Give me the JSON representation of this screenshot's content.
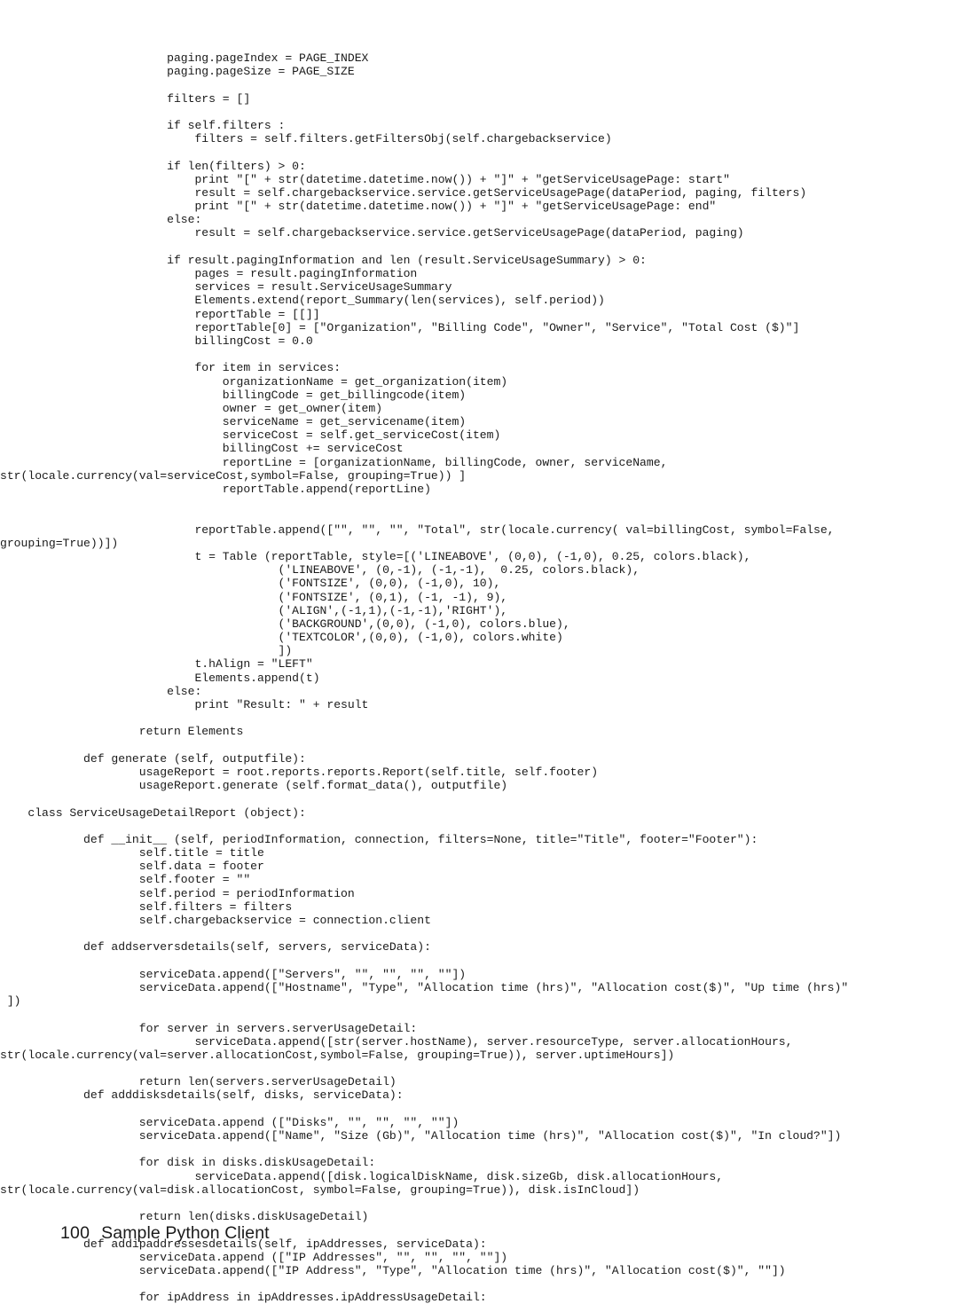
{
  "document": {
    "page_number": "100",
    "section_title": "Sample Python Client"
  },
  "code": {
    "language": "python",
    "lines": [
      "                        paging.pageIndex = PAGE_INDEX",
      "                        paging.pageSize = PAGE_SIZE",
      "",
      "                        filters = []",
      "",
      "                        if self.filters :",
      "                            filters = self.filters.getFiltersObj(self.chargebackservice)",
      "",
      "                        if len(filters) > 0:",
      "                            print \"[\" + str(datetime.datetime.now()) + \"]\" + \"getServiceUsagePage: start\"",
      "                            result = self.chargebackservice.service.getServiceUsagePage(dataPeriod, paging, filters)",
      "                            print \"[\" + str(datetime.datetime.now()) + \"]\" + \"getServiceUsagePage: end\"",
      "                        else:",
      "                            result = self.chargebackservice.service.getServiceUsagePage(dataPeriod, paging)",
      "",
      "                        if result.pagingInformation and len (result.ServiceUsageSummary) > 0:",
      "                            pages = result.pagingInformation",
      "                            services = result.ServiceUsageSummary",
      "                            Elements.extend(report_Summary(len(services), self.period))",
      "                            reportTable = [[]]",
      "                            reportTable[0] = [\"Organization\", \"Billing Code\", \"Owner\", \"Service\", \"Total Cost ($)\"]",
      "                            billingCost = 0.0",
      "",
      "                            for item in services:",
      "                                organizationName = get_organization(item)",
      "                                billingCode = get_billingcode(item)",
      "                                owner = get_owner(item)",
      "                                serviceName = get_servicename(item)",
      "                                serviceCost = self.get_serviceCost(item)",
      "                                billingCost += serviceCost",
      "                                reportLine = [organizationName, billingCode, owner, serviceName,",
      "str(locale.currency(val=serviceCost,symbol=False, grouping=True)) ]",
      "                                reportTable.append(reportLine)",
      "",
      "",
      "                            reportTable.append([\"\", \"\", \"\", \"Total\", str(locale.currency( val=billingCost, symbol=False,",
      "grouping=True))])",
      "                            t = Table (reportTable, style=[('LINEABOVE', (0,0), (-1,0), 0.25, colors.black),",
      "                                        ('LINEABOVE', (0,-1), (-1,-1),  0.25, colors.black),",
      "                                        ('FONTSIZE', (0,0), (-1,0), 10),",
      "                                        ('FONTSIZE', (0,1), (-1, -1), 9),",
      "                                        ('ALIGN',(-1,1),(-1,-1),'RIGHT'),",
      "                                        ('BACKGROUND',(0,0), (-1,0), colors.blue),",
      "                                        ('TEXTCOLOR',(0,0), (-1,0), colors.white)",
      "                                        ])",
      "                            t.hAlign = \"LEFT\"",
      "                            Elements.append(t)",
      "                        else:",
      "                            print \"Result: \" + result",
      "",
      "                    return Elements",
      "",
      "            def generate (self, outputfile):",
      "                    usageReport = root.reports.reports.Report(self.title, self.footer)",
      "                    usageReport.generate (self.format_data(), outputfile)",
      "",
      "    class ServiceUsageDetailReport (object):",
      "",
      "            def __init__ (self, periodInformation, connection, filters=None, title=\"Title\", footer=\"Footer\"):",
      "                    self.title = title",
      "                    self.data = footer",
      "                    self.footer = \"\"",
      "                    self.period = periodInformation",
      "                    self.filters = filters",
      "                    self.chargebackservice = connection.client",
      "",
      "            def addserversdetails(self, servers, serviceData):",
      "",
      "                    serviceData.append([\"Servers\", \"\", \"\", \"\", \"\"])",
      "                    serviceData.append([\"Hostname\", \"Type\", \"Allocation time (hrs)\", \"Allocation cost($)\", \"Up time (hrs)\"",
      " ])",
      "",
      "                    for server in servers.serverUsageDetail:",
      "                            serviceData.append([str(server.hostName), server.resourceType, server.allocationHours,",
      "str(locale.currency(val=server.allocationCost,symbol=False, grouping=True)), server.uptimeHours])",
      "",
      "                    return len(servers.serverUsageDetail)",
      "            def adddisksdetails(self, disks, serviceData):",
      "",
      "                    serviceData.append ([\"Disks\", \"\", \"\", \"\", \"\"])",
      "                    serviceData.append([\"Name\", \"Size (Gb)\", \"Allocation time (hrs)\", \"Allocation cost($)\", \"In cloud?\"])",
      "",
      "                    for disk in disks.diskUsageDetail:",
      "                            serviceData.append([disk.logicalDiskName, disk.sizeGb, disk.allocationHours,",
      "str(locale.currency(val=disk.allocationCost, symbol=False, grouping=True)), disk.isInCloud])",
      "",
      "                    return len(disks.diskUsageDetail)",
      "",
      "            def addipaddressesdetails(self, ipAddresses, serviceData):",
      "                    serviceData.append ([\"IP Addresses\", \"\", \"\", \"\", \"\"])",
      "                    serviceData.append([\"IP Address\", \"Type\", \"Allocation time (hrs)\", \"Allocation cost($)\", \"\"])",
      "",
      "                    for ipAddress in ipAddresses.ipAddressUsageDetail:"
    ]
  }
}
